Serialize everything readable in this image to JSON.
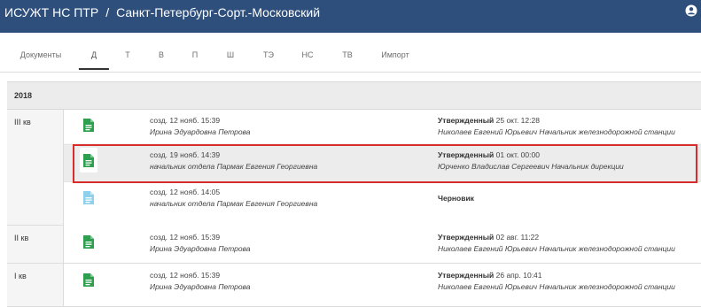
{
  "header": {
    "app_title": "ИСУЖТ НС ПТР",
    "separator": "/",
    "station": "Санкт-Петербург-Сорт.-Московский",
    "user_icon": "user-circle-icon"
  },
  "tabs": [
    {
      "label": "Документы",
      "active": false
    },
    {
      "label": "Д",
      "active": true
    },
    {
      "label": "Т",
      "active": false
    },
    {
      "label": "В",
      "active": false
    },
    {
      "label": "П",
      "active": false
    },
    {
      "label": "Ш",
      "active": false
    },
    {
      "label": "ТЭ",
      "active": false
    },
    {
      "label": "НС",
      "active": false
    },
    {
      "label": "ТВ",
      "active": false
    },
    {
      "label": "Импорт",
      "active": false
    }
  ],
  "year": "2018",
  "quarters": [
    {
      "label": "III кв",
      "docs": [
        {
          "created": "созд. 12 нояб. 15:39",
          "author": "Ирина Эдуардовна Петрова",
          "status": "Утвержденный",
          "status_date": " 25 окт. 12:28",
          "approver": "Николаев Евгений Юрьевич Начальник железнодорожной станции",
          "icon": "document-icon",
          "icon_color": "#2e9e4f"
        },
        {
          "created": "созд. 19 нояб. 14:39",
          "author": "начальник отдела Пармак Евгения Георгиевна",
          "status": "Утвержденный",
          "status_date": " 01 окт. 00:00",
          "approver": "Юрченко Владислав Сергеевич Начальник дирекции",
          "icon": "document-icon",
          "icon_color": "#2e9e4f"
        },
        {
          "created": "созд. 12 нояб. 14:05",
          "author": "начальник отдела Пармак Евгения Георгиевна",
          "status": "Черновик",
          "status_date": "",
          "approver": "",
          "icon": "document-icon",
          "icon_color": "#8fd0ec"
        }
      ]
    },
    {
      "label": "II кв",
      "docs": [
        {
          "created": "созд. 12 нояб. 15:39",
          "author": "Ирина Эдуардовна Петрова",
          "status": "Утвержденный",
          "status_date": " 02 авг. 11:22",
          "approver": "Николаев Евгений Юрьевич Начальник железнодорожной станции",
          "icon": "document-icon",
          "icon_color": "#2e9e4f"
        }
      ]
    },
    {
      "label": "I кв",
      "docs": [
        {
          "created": "созд. 12 нояб. 15:39",
          "author": "Ирина Эдуардовна Петрова",
          "status": "Утвержденный",
          "status_date": " 26 апр. 10:41",
          "approver": "Николаев Евгений Юрьевич Начальник железнодорожной станции",
          "icon": "document-icon",
          "icon_color": "#2e9e4f"
        }
      ]
    }
  ],
  "colors": {
    "header_bg": "#2e4f7c",
    "selection_border": "#d72c2c",
    "approved_icon": "#2e9e4f",
    "draft_icon": "#8fd0ec"
  }
}
